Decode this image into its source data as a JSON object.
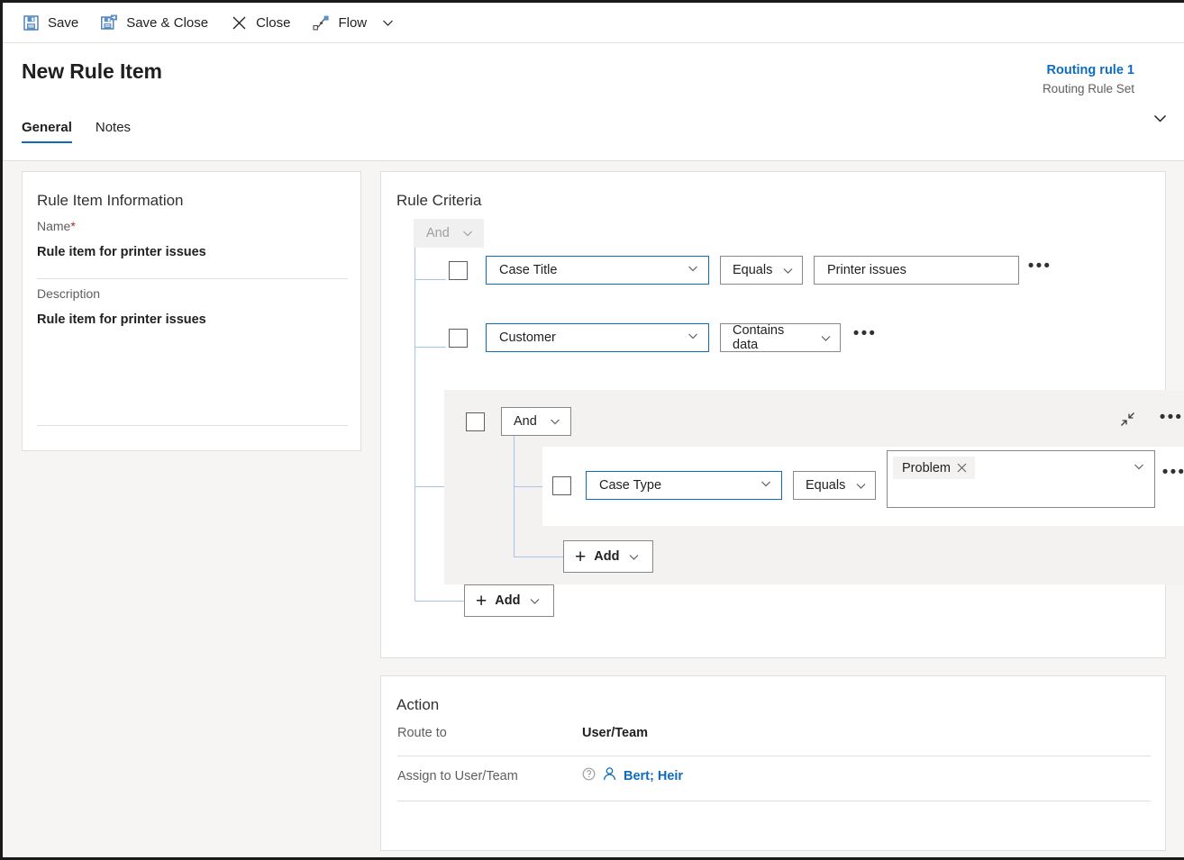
{
  "commandbar": {
    "items": [
      {
        "id": "save",
        "label": "Save",
        "icon": "save-icon"
      },
      {
        "id": "save-close",
        "label": "Save & Close",
        "icon": "save-and-close-icon"
      },
      {
        "id": "close",
        "label": "Close",
        "icon": "close-x-icon"
      },
      {
        "id": "flow",
        "label": "Flow",
        "icon": "flow-icon"
      }
    ],
    "overflow_caret": "chevron-down-icon"
  },
  "header": {
    "title": "New Rule Item",
    "record_name": "Routing rule 1",
    "record_entity": "Routing Rule Set",
    "expand_caret": "chevron-down-icon",
    "tabs": [
      {
        "id": "general",
        "label": "General",
        "selected": true
      },
      {
        "id": "notes",
        "label": "Notes",
        "selected": false
      }
    ]
  },
  "rule_item_information": {
    "title": "Rule Item Information",
    "name_label": "Name",
    "name_required_marker": "*",
    "name_value": "Rule item for printer issues",
    "description_label": "Description",
    "description_value": "Rule item for printer issues"
  },
  "rule_criteria": {
    "title": "Rule Criteria",
    "root_logic": {
      "value": "And",
      "disabled": true
    },
    "conditions": [
      {
        "field": "Case Title",
        "operator": "Equals",
        "value": "Printer issues",
        "more_label": "•••"
      },
      {
        "field": "Customer",
        "operator": "Contains data",
        "value": null,
        "more_label": "•••"
      }
    ],
    "group": {
      "logic": "And",
      "collapse_icon": "collapse-icon",
      "more_label": "•••",
      "conditions": [
        {
          "field": "Case Type",
          "operator": "Equals",
          "tags": [
            "Problem"
          ],
          "more_label": "•••"
        }
      ],
      "add_label": "Add"
    },
    "add_label": "Add"
  },
  "action": {
    "title": "Action",
    "route_to_label": "Route to",
    "route_to_value": "User/Team",
    "assign_label": "Assign to User/Team",
    "assign_value": "Bert; Heir"
  },
  "colors": {
    "accent_blue": "#0f6cbd",
    "link_blue": "#0f6cbd",
    "required_red": "#a4262c",
    "group_bg": "#f3f2f1",
    "connector_blue": "#a7c7ea"
  }
}
